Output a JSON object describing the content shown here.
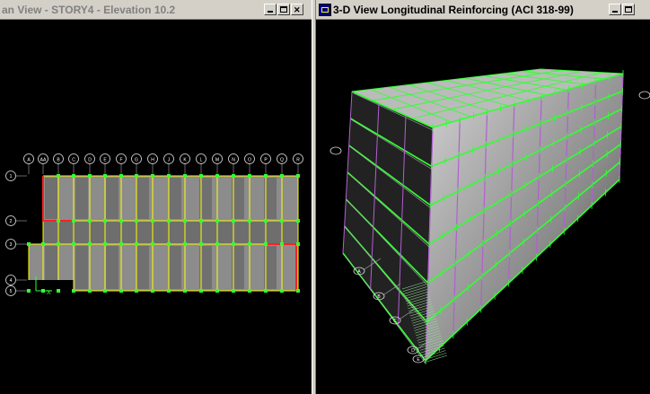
{
  "left_window": {
    "title": "an View - STORY4 - Elevation 10.2",
    "grid_labels_x": [
      "A",
      "AA",
      "B",
      "C",
      "D",
      "E",
      "F",
      "G",
      "H",
      "J",
      "K",
      "L",
      "M",
      "N",
      "O",
      "P",
      "Q",
      "R"
    ],
    "grid_labels_y": [
      "1",
      "2",
      "3",
      "4",
      "5"
    ]
  },
  "right_window": {
    "title": "3-D View  Longitudinal Reinforcing  (ACI 318-99)",
    "grid_labels": [
      "A",
      "B",
      "C",
      "D",
      "E"
    ]
  },
  "colors": {
    "canvas_bg": "#000000",
    "beam_yellow": "#ffff00",
    "rebar_green": "#33ff33",
    "slab_gray": "#8a8a8a",
    "wall_red": "#ff2020",
    "column_purple": "#b060d0"
  }
}
